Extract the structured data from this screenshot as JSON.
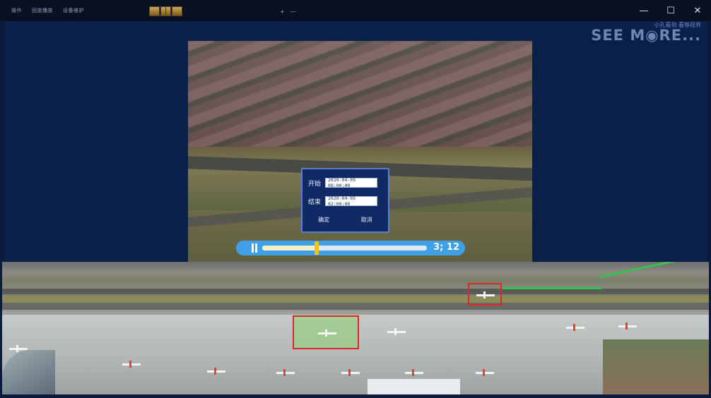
{
  "menu": {
    "items": [
      "操作",
      "回放播放",
      "设备维护"
    ]
  },
  "top_controls": {
    "center": [
      "+",
      "—"
    ]
  },
  "window_controls": {
    "minimize": "—",
    "maximize": "☐",
    "close": "✕"
  },
  "brand": {
    "subtitle": "小孔看到 看够视界",
    "logo": "SEE M◉RE..."
  },
  "dialog": {
    "start_label": "开始",
    "start_value": "2020-04-05  08:00:00",
    "end_label": "结束",
    "end_value": "2020-04-05  02:00:00",
    "confirm_label": "确定",
    "cancel_label": "取消"
  },
  "playback": {
    "time": "3; 12",
    "progress": 0.33
  },
  "colors": {
    "accent": "#3fa0e8",
    "thumb": "#f4c21e",
    "highlight": "#e02525",
    "trail": "#36c24b"
  },
  "icons": [
    "layout-single-icon",
    "layout-grid-icon",
    "layout-multi-icon",
    "pause-icon"
  ]
}
